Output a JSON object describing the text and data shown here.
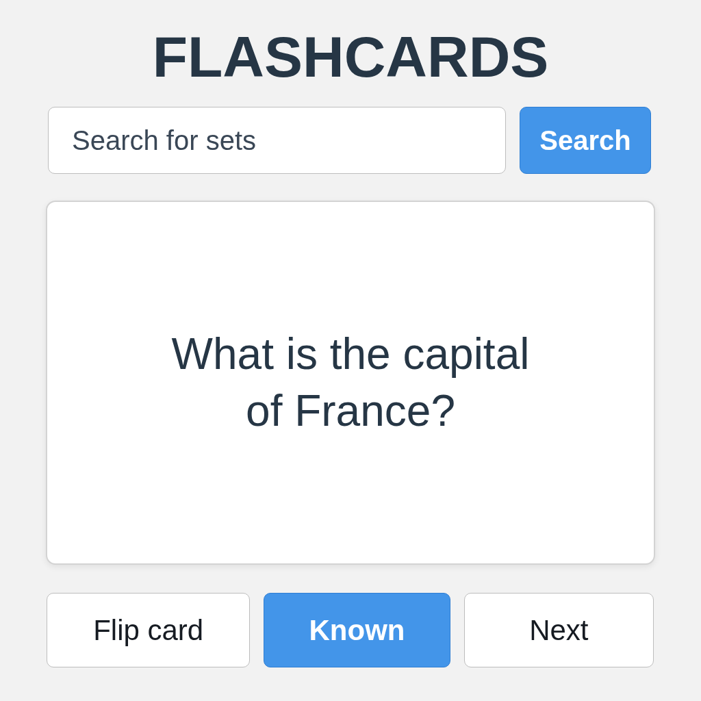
{
  "title": "FLASHCARDS",
  "search": {
    "placeholder": "Search for sets",
    "button": {
      "label": "Search",
      "kind": "primary"
    }
  },
  "card": {
    "text": "What is the capital of France?"
  },
  "buttons": [
    {
      "label": "Flip card",
      "kind": "secondary"
    },
    {
      "label": "Known",
      "kind": "primary"
    },
    {
      "label": "Next",
      "kind": "secondary"
    }
  ]
}
